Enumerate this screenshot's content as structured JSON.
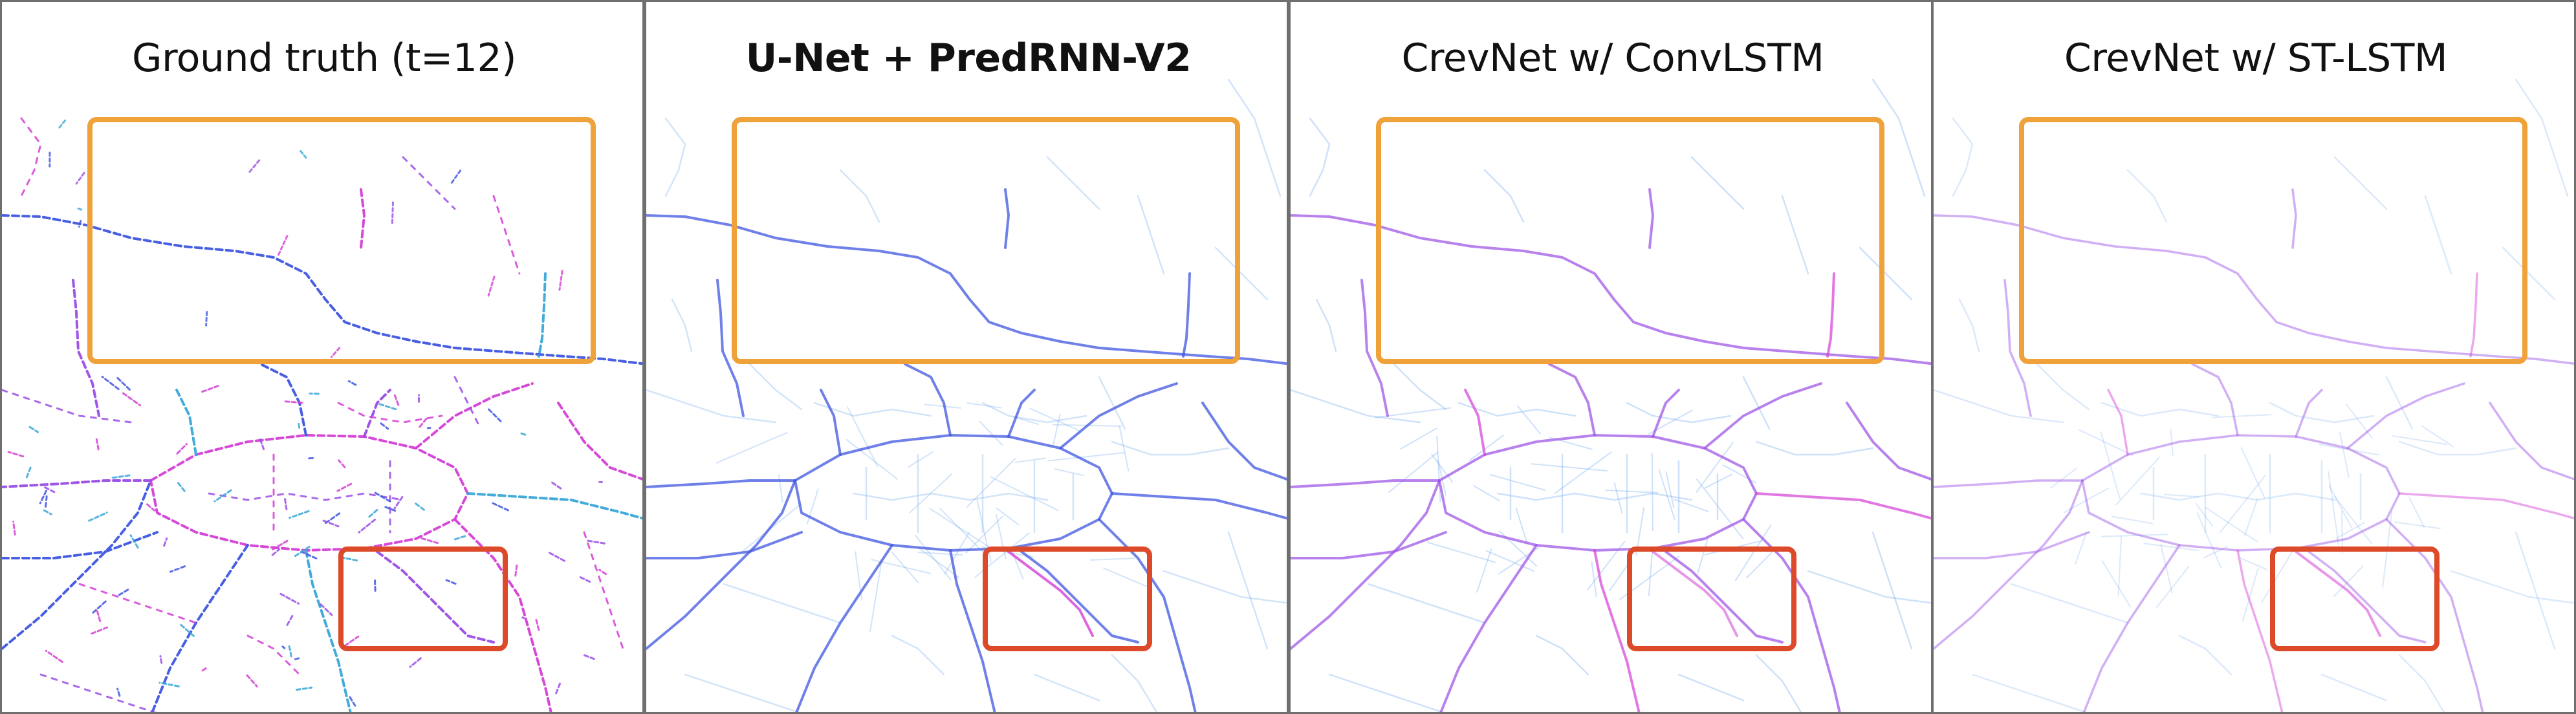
{
  "panels": [
    {
      "title": "Ground truth (t=12)",
      "bold": false,
      "style": "sparse"
    },
    {
      "title": "U-Net + PredRNN-V2",
      "bold": true,
      "style": "dense"
    },
    {
      "title": "CrevNet w/ ConvLSTM",
      "bold": false,
      "style": "dense-purple"
    },
    {
      "title": "CrevNet w/ ST-LSTM",
      "bold": false,
      "style": "dense-light"
    }
  ],
  "colors": {
    "highlight_box_top": "#f0a23a",
    "highlight_box_bottom": "#dc4a2a",
    "panel_border": "#6f6f6f",
    "road_blue": "#3f56e0",
    "road_light_blue": "#7fb1ee",
    "road_purple": "#9a4de6",
    "road_magenta": "#d43fd6",
    "road_cyan": "#39a6d8"
  }
}
